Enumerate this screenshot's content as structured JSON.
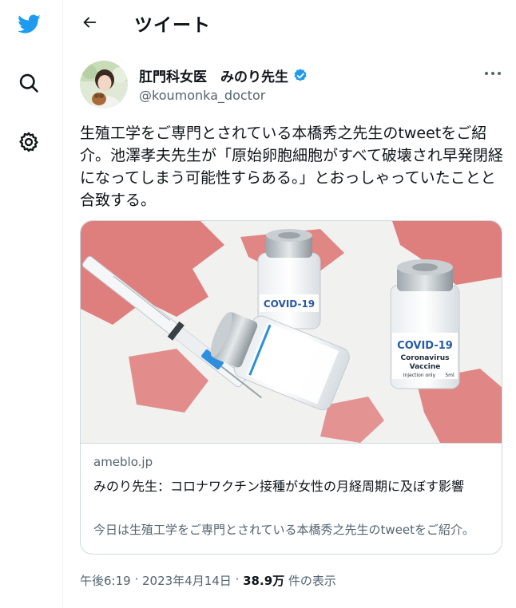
{
  "colors": {
    "brand": "#1d9bf0",
    "text_primary": "#0f1419",
    "text_secondary": "#536471",
    "border": "#cfd9de"
  },
  "sidebar": {
    "items": [
      {
        "icon": "twitter-logo-icon"
      },
      {
        "icon": "search-icon"
      },
      {
        "icon": "settings-gear-icon"
      }
    ]
  },
  "header": {
    "back_icon": "back-arrow-icon",
    "title": "ツイート"
  },
  "tweet": {
    "author": {
      "display_name": "肛門科女医　みのり先生",
      "verified": true,
      "handle": "@koumonka_doctor"
    },
    "more_icon": "more-options-icon",
    "text": "生殖工学をご専門とされている本橋秀之先生のtweetをご紹介。池澤孝夫先生が「原始卵胞細胞がすべて破壊され早発閉経になってしまう可能性すらある。」とおっしゃっていたことと合致する。",
    "card": {
      "image_labels": {
        "vial_a_brand": "COVID-19",
        "vial_b_brand": "COVID-19",
        "vial_b_line1": "Coronavirus",
        "vial_b_line2": "Vaccine",
        "vial_b_line3": "Injection only",
        "vial_b_dose": "5ml"
      },
      "domain": "ameblo.jp",
      "title": "みのり先生：コロナワクチン接種が女性の月経周期に及ぼす影響",
      "description": "今日は生殖工学をご専門とされている本橋秀之先生のtweetをご紹介。"
    },
    "meta": {
      "time": "午後6:19",
      "separator": " · ",
      "date": "2023年4月14日",
      "separator2": " · ",
      "views_count": "38.9万",
      "views_label": " 件の表示"
    }
  }
}
